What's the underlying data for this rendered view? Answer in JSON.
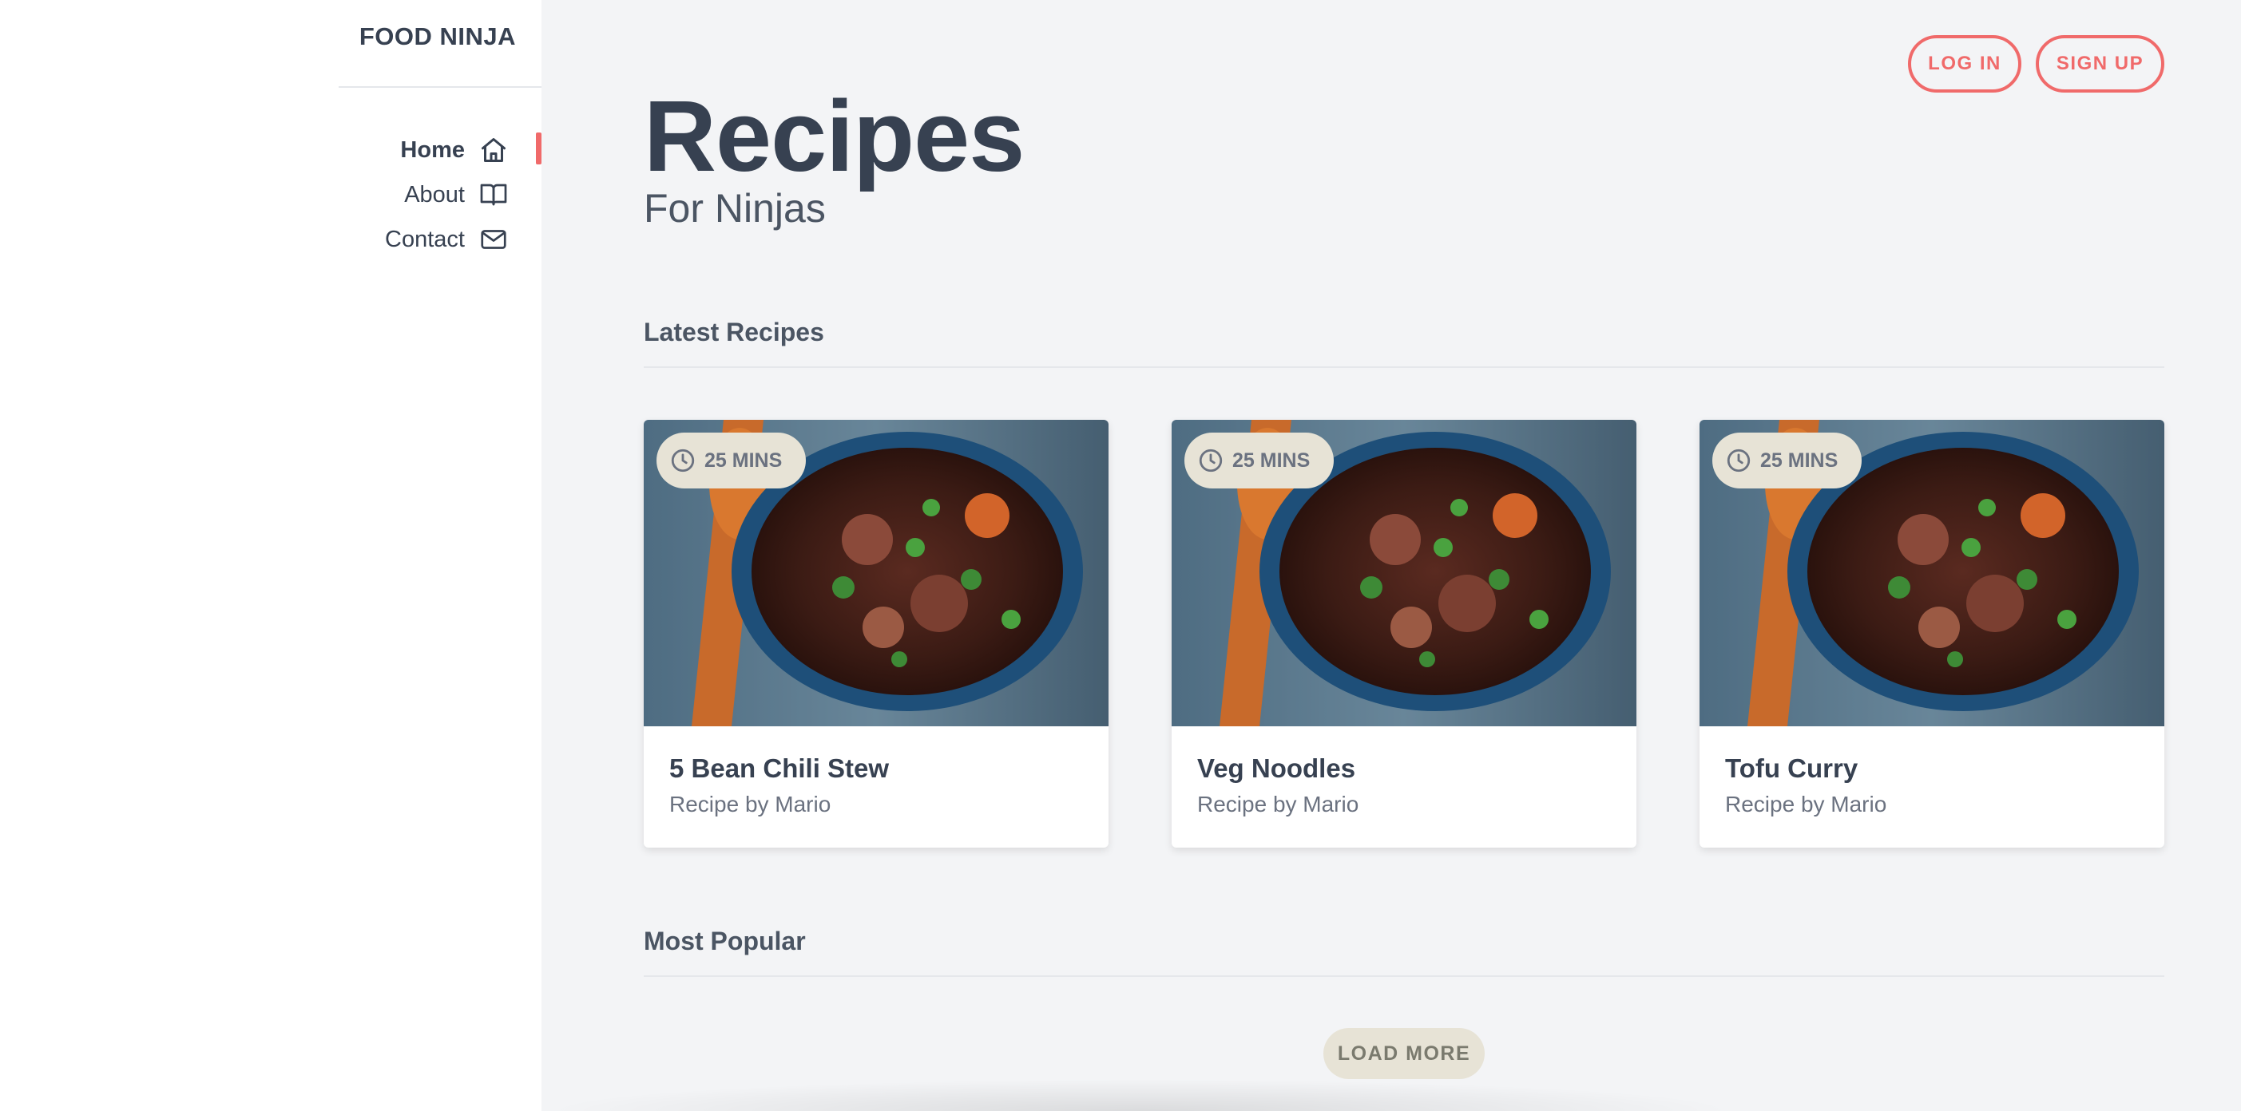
{
  "sidebar": {
    "brand": "FOOD NINJA",
    "nav": [
      {
        "label": "Home",
        "icon": "home-icon",
        "active": true
      },
      {
        "label": "About",
        "icon": "book-icon",
        "active": false
      },
      {
        "label": "Contact",
        "icon": "mail-icon",
        "active": false
      }
    ]
  },
  "header": {
    "login_label": "LOG IN",
    "signup_label": "SIGN UP",
    "title": "Recipes",
    "subtitle": "For Ninjas"
  },
  "sections": {
    "latest": "Latest Recipes",
    "popular": "Most Popular"
  },
  "recipes": [
    {
      "title": "5 Bean Chili Stew",
      "author": "Recipe by Mario",
      "time": "25 MINS"
    },
    {
      "title": "Veg Noodles",
      "author": "Recipe by Mario",
      "time": "25 MINS"
    },
    {
      "title": "Tofu Curry",
      "author": "Recipe by Mario",
      "time": "25 MINS"
    }
  ],
  "load_more_label": "LOAD MORE",
  "colors": {
    "accent": "#f06a6a",
    "sidebar_bg": "#ffffff",
    "content_bg": "#f3f4f6",
    "text": "#374151",
    "badge_bg": "#e7e3d6"
  }
}
